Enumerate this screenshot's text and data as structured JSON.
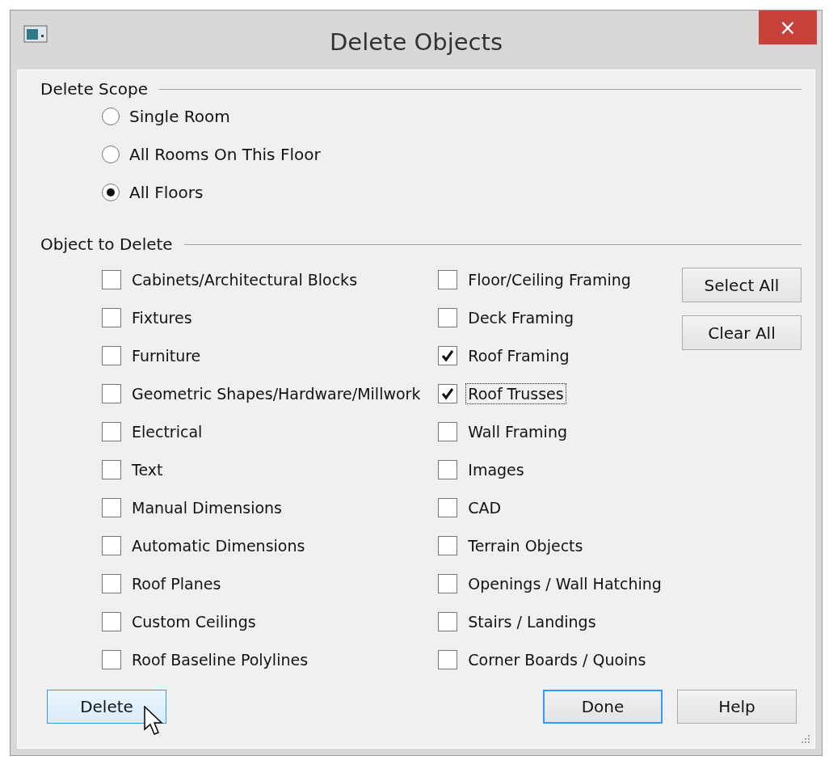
{
  "window": {
    "title": "Delete Objects",
    "close": "×"
  },
  "delete_scope": {
    "heading": "Delete Scope",
    "options": [
      {
        "label": "Single Room",
        "selected": false
      },
      {
        "label": "All Rooms On This Floor",
        "selected": false
      },
      {
        "label": "All Floors",
        "selected": true
      }
    ]
  },
  "object_to_delete": {
    "heading": "Object to Delete",
    "columns": [
      [
        {
          "label": "Cabinets/Architectural Blocks",
          "checked": false,
          "focused": false
        },
        {
          "label": "Fixtures",
          "checked": false,
          "focused": false
        },
        {
          "label": "Furniture",
          "checked": false,
          "focused": false
        },
        {
          "label": "Geometric Shapes/Hardware/Millwork",
          "checked": false,
          "focused": false
        },
        {
          "label": "Electrical",
          "checked": false,
          "focused": false
        },
        {
          "label": "Text",
          "checked": false,
          "focused": false
        },
        {
          "label": "Manual Dimensions",
          "checked": false,
          "focused": false
        },
        {
          "label": "Automatic Dimensions",
          "checked": false,
          "focused": false
        },
        {
          "label": "Roof Planes",
          "checked": false,
          "focused": false
        },
        {
          "label": "Custom Ceilings",
          "checked": false,
          "focused": false
        },
        {
          "label": "Roof Baseline Polylines",
          "checked": false,
          "focused": false
        }
      ],
      [
        {
          "label": "Floor/Ceiling Framing",
          "checked": false,
          "focused": false
        },
        {
          "label": "Deck Framing",
          "checked": false,
          "focused": false
        },
        {
          "label": "Roof Framing",
          "checked": true,
          "focused": false
        },
        {
          "label": "Roof Trusses",
          "checked": true,
          "focused": true
        },
        {
          "label": "Wall Framing",
          "checked": false,
          "focused": false
        },
        {
          "label": "Images",
          "checked": false,
          "focused": false
        },
        {
          "label": "CAD",
          "checked": false,
          "focused": false
        },
        {
          "label": "Terrain Objects",
          "checked": false,
          "focused": false
        },
        {
          "label": "Openings / Wall Hatching",
          "checked": false,
          "focused": false
        },
        {
          "label": "Stairs / Landings",
          "checked": false,
          "focused": false
        },
        {
          "label": "Corner Boards / Quoins",
          "checked": false,
          "focused": false
        }
      ]
    ],
    "side_buttons": [
      {
        "label": "Select All"
      },
      {
        "label": "Clear All"
      }
    ]
  },
  "footer_buttons": [
    {
      "label": "Delete",
      "kind": "hovered"
    },
    {
      "label": "Done",
      "kind": "default"
    },
    {
      "label": "Help",
      "kind": "normal"
    }
  ]
}
